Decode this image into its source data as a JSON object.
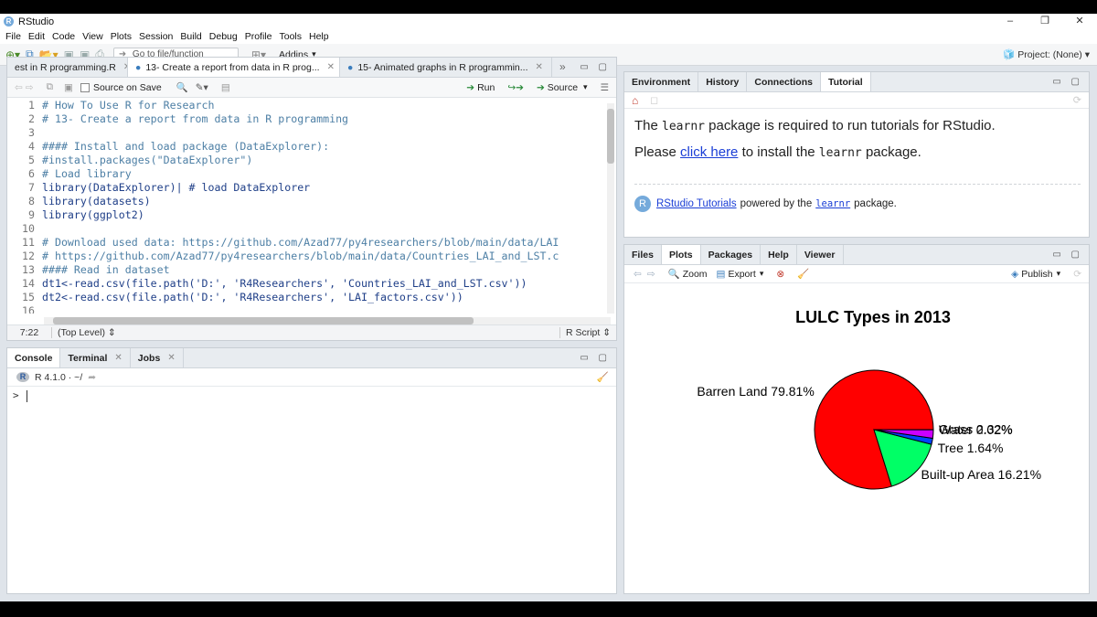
{
  "window": {
    "title": "RStudio",
    "min": "–",
    "max": "❐",
    "close": "✕"
  },
  "menu": [
    "File",
    "Edit",
    "Code",
    "View",
    "Plots",
    "Session",
    "Build",
    "Debug",
    "Profile",
    "Tools",
    "Help"
  ],
  "toolbar": {
    "goto_placeholder": "Go to file/function",
    "addins": "Addins",
    "project": "Project: (None)"
  },
  "editor": {
    "tabs": [
      {
        "label": "est in R programming.R"
      },
      {
        "label": "13- Create a report from data in R prog..."
      },
      {
        "label": "15- Animated graphs in R programmin..."
      }
    ],
    "source_on_save": "Source on Save",
    "run": "Run",
    "source": "Source",
    "lines": [
      {
        "n": "1",
        "code": "# How To Use R for Research"
      },
      {
        "n": "2",
        "code": "# 13- Create a report from data in R programming"
      },
      {
        "n": "3",
        "code": ""
      },
      {
        "n": "4",
        "code": "#### Install and load package (DataExplorer):"
      },
      {
        "n": "5",
        "code": "#install.packages(\"DataExplorer\")"
      },
      {
        "n": "6",
        "code": "# Load library"
      },
      {
        "n": "7",
        "code": "library(DataExplorer)| # load DataExplorer"
      },
      {
        "n": "8",
        "code": "library(datasets)"
      },
      {
        "n": "9",
        "code": "library(ggplot2)"
      },
      {
        "n": "10",
        "code": ""
      },
      {
        "n": "11",
        "code": "# Download used data: https://github.com/Azad77/py4researchers/blob/main/data/LAI"
      },
      {
        "n": "12",
        "code": "# https://github.com/Azad77/py4researchers/blob/main/data/Countries_LAI_and_LST.c"
      },
      {
        "n": "13",
        "code": "#### Read in dataset"
      },
      {
        "n": "14",
        "code": "dt1<-read.csv(file.path('D:', 'R4Researchers', 'Countries_LAI_and_LST.csv'))"
      },
      {
        "n": "15",
        "code": "dt2<-read.csv(file.path('D:', 'R4Researchers', 'LAI_factors.csv'))"
      },
      {
        "n": "16",
        "code": ""
      }
    ],
    "status_pos": "7:22",
    "status_scope": "(Top Level) ⇕",
    "status_type": "R Script ⇕"
  },
  "console": {
    "tabs": [
      {
        "label": "Console"
      },
      {
        "label": "Terminal"
      },
      {
        "label": "Jobs"
      }
    ],
    "version": "R 4.1.0 · ~/",
    "prompt": ">"
  },
  "env_pane": {
    "tabs": [
      {
        "label": "Environment"
      },
      {
        "label": "History"
      },
      {
        "label": "Connections"
      },
      {
        "label": "Tutorial"
      }
    ],
    "p1_a": "The",
    "p1_pkg": "learnr",
    "p1_b": "package is required to run tutorials for RStudio.",
    "p2_a": "Please",
    "p2_link": "click here",
    "p2_b": "to install the",
    "p2_pkg": "learnr",
    "p2_c": "package.",
    "foot_link": "RStudio Tutorials",
    "foot_a": "powered by the",
    "foot_pkg": "learnr",
    "foot_b": "package."
  },
  "plots_pane": {
    "tabs": [
      {
        "label": "Files"
      },
      {
        "label": "Plots"
      },
      {
        "label": "Packages"
      },
      {
        "label": "Help"
      },
      {
        "label": "Viewer"
      }
    ],
    "zoom": "Zoom",
    "export": "Export",
    "publish": "Publish"
  },
  "chart_data": {
    "type": "pie",
    "title": "LULC Types in 2013",
    "labels": [
      "Barren Land 79.81%",
      "Built-up Area 16.21%",
      "Tree 1.64%",
      "Grass 2.32%",
      "Water 0.02%"
    ],
    "categories": [
      "Barren Land",
      "Built-up Area",
      "Tree",
      "Grass",
      "Water"
    ],
    "values": [
      79.81,
      16.21,
      1.64,
      2.32,
      0.02
    ],
    "colors": [
      "#ff0000",
      "#00ff66",
      "#0044ff",
      "#cc00ff",
      "#00ffff"
    ],
    "start_angle_deg": 0,
    "direction": "counterclockwise"
  }
}
